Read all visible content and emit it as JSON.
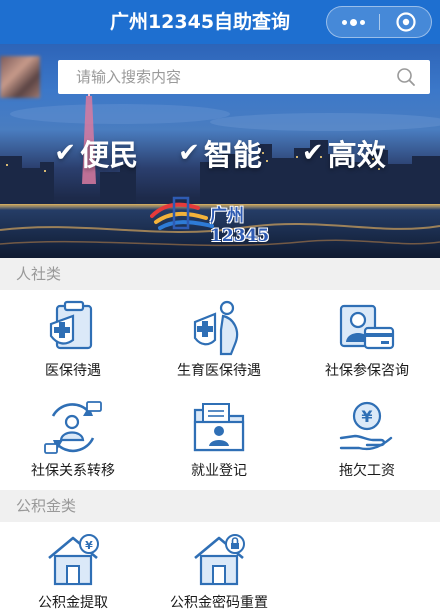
{
  "topbar": {
    "title": "广州12345自助查询",
    "more_icon": "more-dots-icon",
    "close_icon": "target-close-icon"
  },
  "banner": {
    "search_placeholder": "请输入搜索内容",
    "slogans": [
      "便民",
      "智能",
      "高效"
    ],
    "logo_text": "广州12345"
  },
  "sections": [
    {
      "title": "人社类",
      "items": [
        {
          "label": "医保待遇",
          "icon": "medical-clipboard-icon"
        },
        {
          "label": "生育医保待遇",
          "icon": "pregnant-woman-icon"
        },
        {
          "label": "社保参保咨询",
          "icon": "id-card-icon"
        },
        {
          "label": "社保关系转移",
          "icon": "transfer-person-icon"
        },
        {
          "label": "就业登记",
          "icon": "employee-folder-icon"
        },
        {
          "label": "拖欠工资",
          "icon": "yuan-hand-icon"
        }
      ]
    },
    {
      "title": "公积金类",
      "items": [
        {
          "label": "公积金提取",
          "icon": "house-yuan-icon"
        },
        {
          "label": "公积金密码重置",
          "icon": "house-lock-icon"
        }
      ]
    }
  ],
  "colors": {
    "brand_blue": "#1e6fd0",
    "icon_blue": "#2f6fb5",
    "icon_light": "#dbe9f8"
  }
}
